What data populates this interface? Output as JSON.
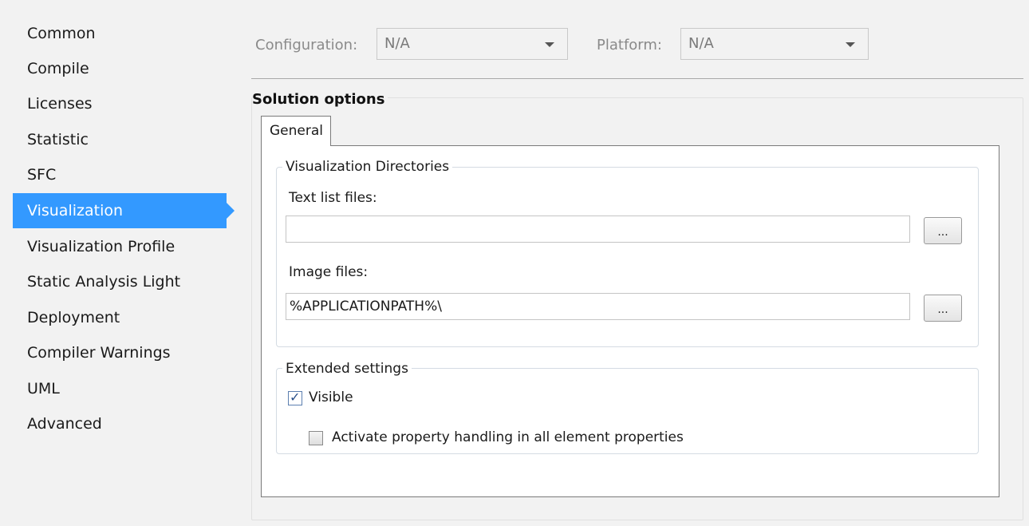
{
  "sidebar": {
    "items": [
      {
        "label": "Common"
      },
      {
        "label": "Compile"
      },
      {
        "label": "Licenses"
      },
      {
        "label": "Statistic"
      },
      {
        "label": "SFC"
      },
      {
        "label": "Visualization",
        "selected": true
      },
      {
        "label": "Visualization Profile"
      },
      {
        "label": "Static Analysis Light"
      },
      {
        "label": "Deployment"
      },
      {
        "label": "Compiler Warnings"
      },
      {
        "label": "UML"
      },
      {
        "label": "Advanced"
      }
    ]
  },
  "header": {
    "configuration_label": "Configuration:",
    "configuration_value": "N/A",
    "platform_label": "Platform:",
    "platform_value": "N/A"
  },
  "solution_options": {
    "title": "Solution options",
    "tab_label": "General",
    "visualization_directories": {
      "title": "Visualization Directories",
      "text_list_label": "Text list files:",
      "text_list_value": "",
      "image_files_label": "Image files:",
      "image_files_value": "%APPLICATIONPATH%\\",
      "browse_label": "..."
    },
    "extended_settings": {
      "title": "Extended settings",
      "visible_label": "Visible",
      "visible_checked": true,
      "property_handling_label": "Activate property handling in all element properties",
      "property_handling_checked": false
    }
  },
  "colors": {
    "selection": "#3399ff",
    "background": "#f2f2f2"
  }
}
